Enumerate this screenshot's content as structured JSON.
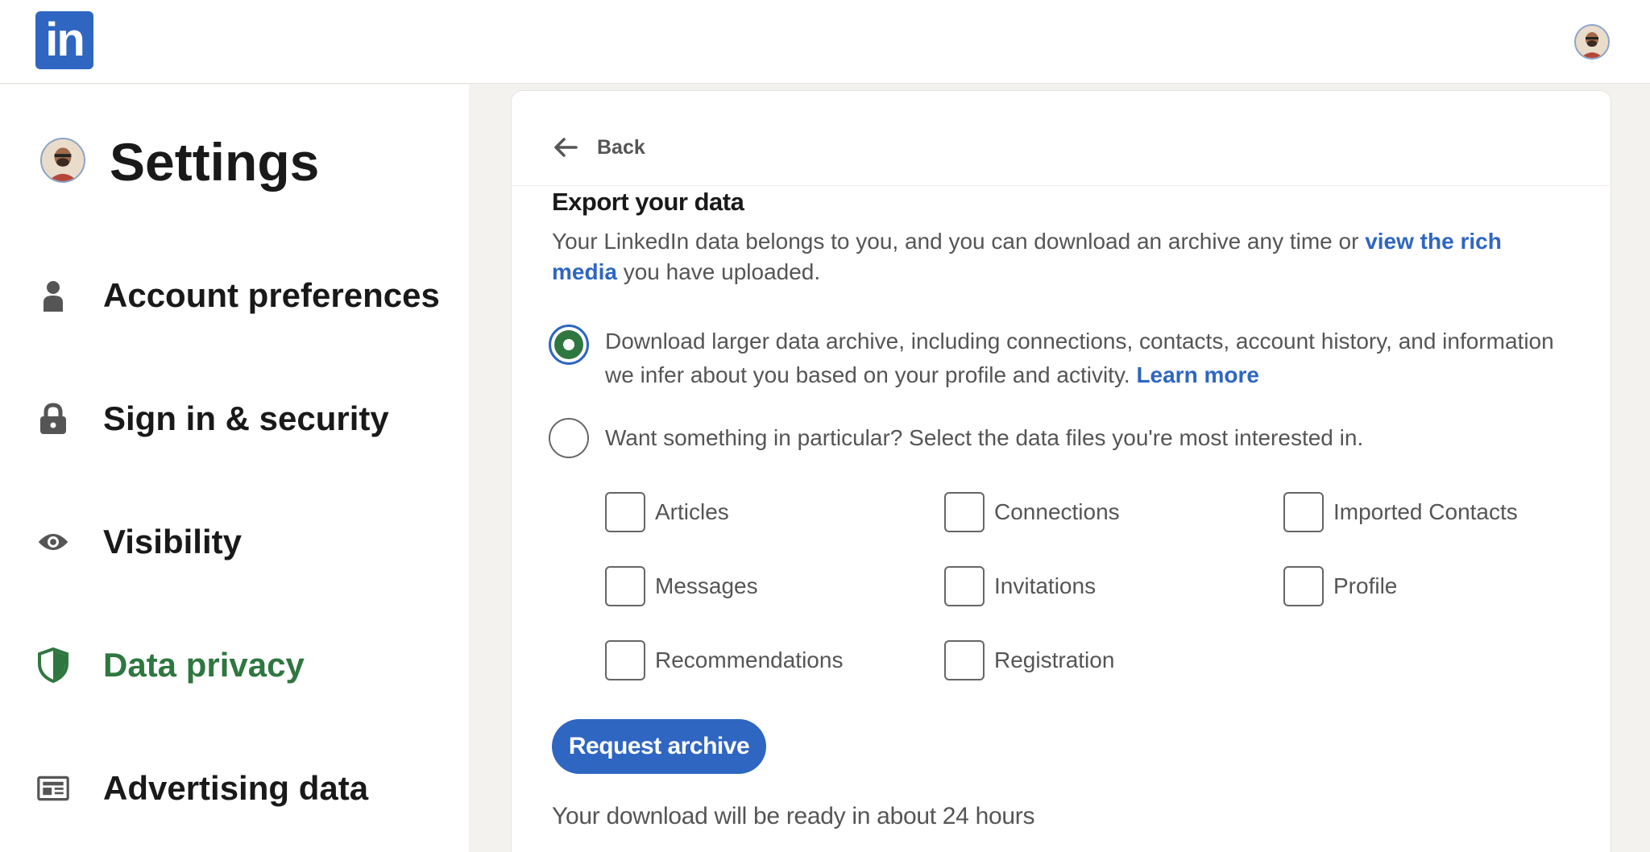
{
  "header": {
    "logo_text": "in",
    "logo_color": "#2e66c2",
    "avatar_icon": "user-avatar-icon"
  },
  "sidebar": {
    "title": "Settings",
    "items": [
      {
        "label": "Account preferences",
        "icon": "person-icon",
        "active": false
      },
      {
        "label": "Sign in & security",
        "icon": "lock-icon",
        "active": false
      },
      {
        "label": "Visibility",
        "icon": "eye-icon",
        "active": false
      },
      {
        "label": "Data privacy",
        "icon": "shield-icon",
        "active": true
      },
      {
        "label": "Advertising data",
        "icon": "ad-icon",
        "active": false
      }
    ],
    "active_color": "#2f7740"
  },
  "main": {
    "back_label": "Back",
    "section_title": "Export your data",
    "description_prefix": "Your LinkedIn data belongs to you, and you can download an archive any time or ",
    "description_link": "view the rich media",
    "description_suffix": " you have uploaded.",
    "option_full": {
      "label": "Download larger data archive, including connections, contacts, account history, and information we infer about you based on your profile and activity.",
      "link": "Learn more",
      "selected": true
    },
    "option_partial": {
      "label": "Want something in particular? Select the data files you're most interested in.",
      "selected": false
    },
    "files": [
      {
        "label": "Articles",
        "checked": false
      },
      {
        "label": "Connections",
        "checked": false
      },
      {
        "label": "Imported Contacts",
        "checked": false
      },
      {
        "label": "Messages",
        "checked": false
      },
      {
        "label": "Invitations",
        "checked": false
      },
      {
        "label": "Profile",
        "checked": false
      },
      {
        "label": "Recommendations",
        "checked": false
      },
      {
        "label": "Registration",
        "checked": false
      }
    ],
    "request_button": "Request archive",
    "ready_note": "Your download will be ready in about 24 hours"
  }
}
